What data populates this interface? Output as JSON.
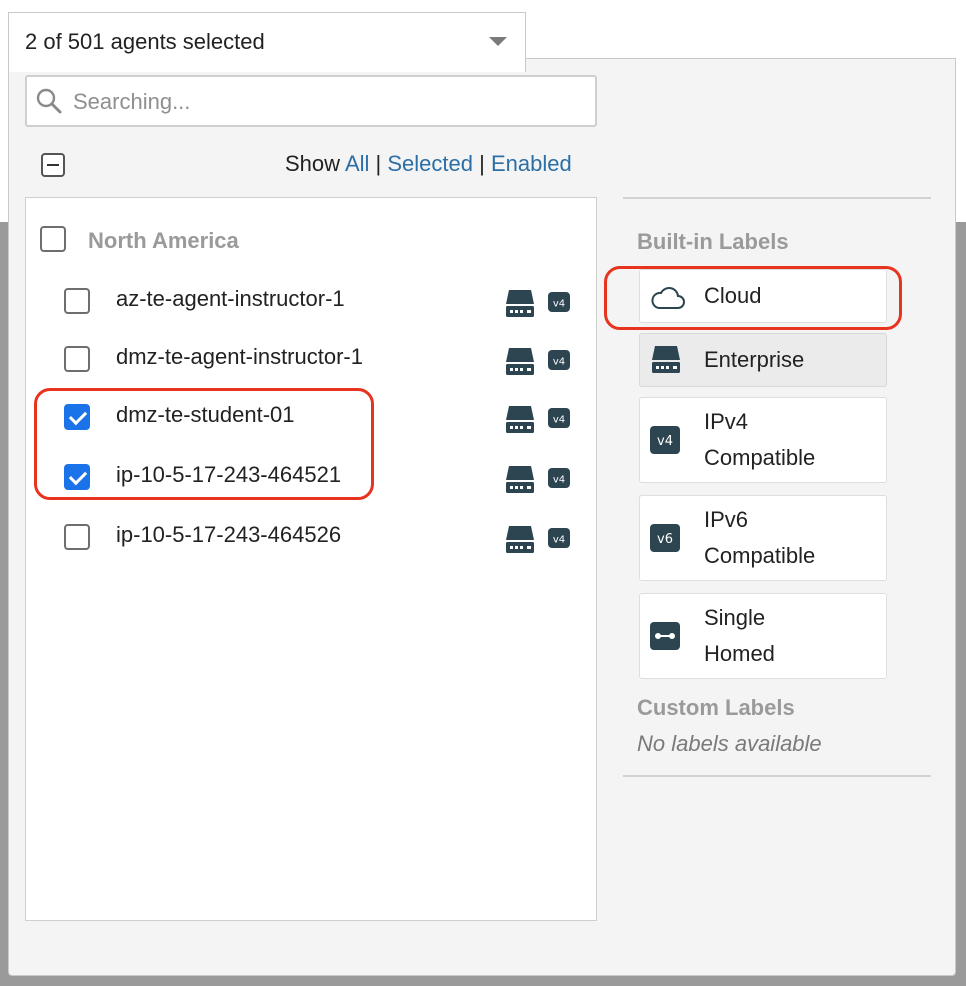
{
  "selector": {
    "summary": "2 of 501 agents selected",
    "search_placeholder": "Searching..."
  },
  "filter": {
    "show_label": "Show",
    "all": "All",
    "separator": "|",
    "selected": "Selected",
    "enabled": "Enabled"
  },
  "groups": [
    {
      "name": "North America",
      "agents": [
        {
          "name": "az-te-agent-instructor-1",
          "checked": false,
          "badge": "v4"
        },
        {
          "name": "dmz-te-agent-instructor-1",
          "checked": false,
          "badge": "v4"
        },
        {
          "name": "dmz-te-student-01",
          "checked": true,
          "badge": "v4"
        },
        {
          "name": "ip-10-5-17-243-464521",
          "checked": true,
          "badge": "v4"
        },
        {
          "name": "ip-10-5-17-243-464526",
          "checked": false,
          "badge": "v4"
        }
      ]
    }
  ],
  "labels": {
    "builtin_heading": "Built-in Labels",
    "builtin": [
      {
        "line1": "Cloud",
        "line2": "",
        "icon": "cloud-icon",
        "active": false
      },
      {
        "line1": "Enterprise",
        "line2": "",
        "icon": "server-icon",
        "active": true
      },
      {
        "line1": "IPv4",
        "line2": "Compatible",
        "icon": "v4",
        "active": false
      },
      {
        "line1": "IPv6",
        "line2": "Compatible",
        "icon": "v6",
        "active": false
      },
      {
        "line1": "Single",
        "line2": "Homed",
        "icon": "single-homed-icon",
        "active": false
      }
    ],
    "custom_heading": "Custom Labels",
    "custom_empty": "No labels available"
  },
  "colors": {
    "link": "#2c6ea6",
    "checkbox_checked": "#1a73e8",
    "annotation": "#e8331f",
    "icon_dark": "#2d4451"
  }
}
